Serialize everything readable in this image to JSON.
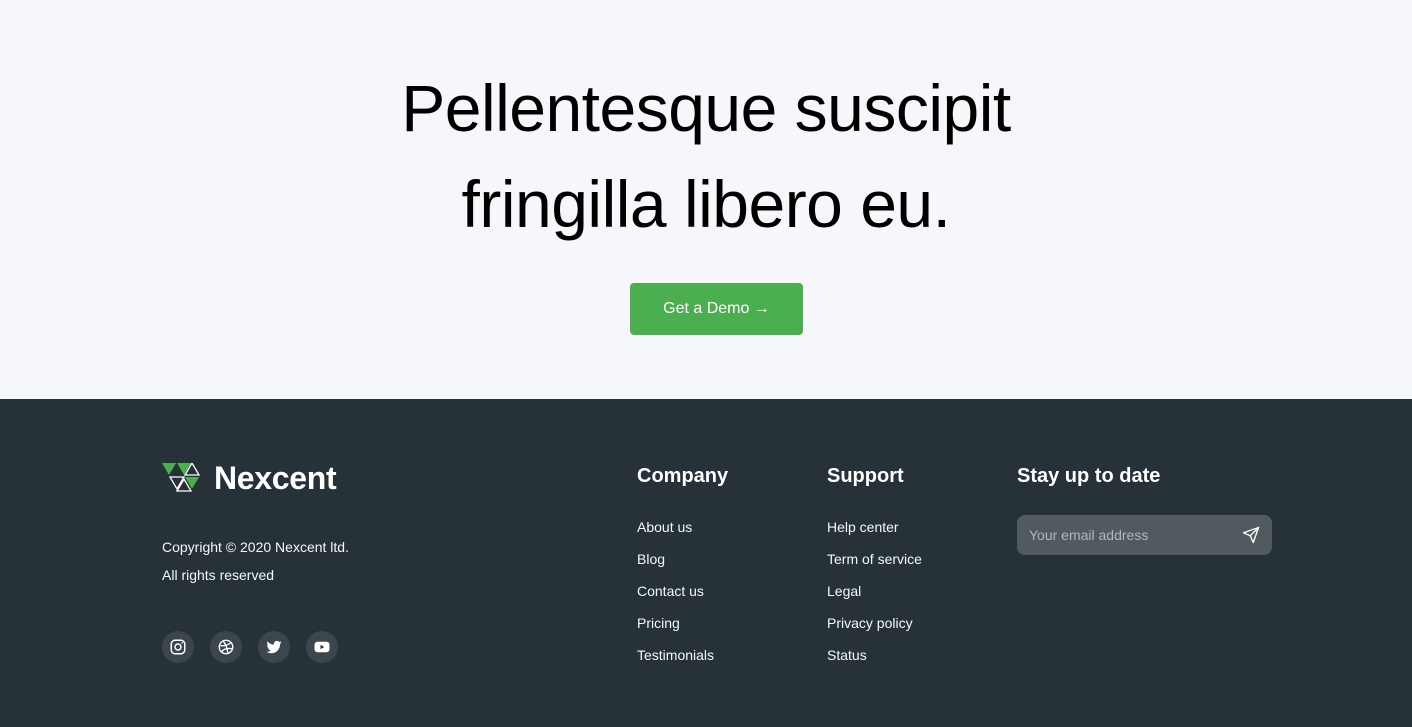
{
  "cta": {
    "title_line1": "Pellentesque suscipit",
    "title_line2": "fringilla libero eu.",
    "button_label": "Get a Demo →"
  },
  "footer": {
    "brand": "Nexcent",
    "copyright_line1": "Copyright © 2020 Nexcent ltd.",
    "copyright_line2": "All rights reserved",
    "socials": [
      "instagram-icon",
      "dribbble-icon",
      "twitter-icon",
      "youtube-icon"
    ],
    "company": {
      "title": "Company",
      "links": [
        "About us",
        "Blog",
        "Contact us",
        "Pricing",
        "Testimonials"
      ]
    },
    "support": {
      "title": "Support",
      "links": [
        "Help center",
        "Term of service",
        "Legal",
        "Privacy policy",
        "Status"
      ]
    },
    "newsletter": {
      "title": "Stay up to date",
      "placeholder": "Your email address"
    }
  },
  "colors": {
    "accent": "#4CAF4F",
    "footer_bg": "#263238",
    "page_bg": "#F5F7FA"
  }
}
